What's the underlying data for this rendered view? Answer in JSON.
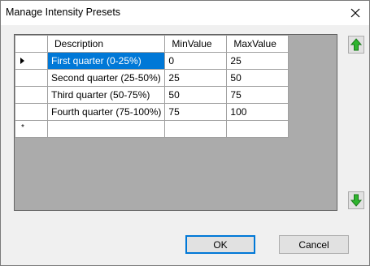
{
  "dialog": {
    "title": "Manage Intensity Presets"
  },
  "grid": {
    "columns": [
      "Description",
      "MinValue",
      "MaxValue"
    ],
    "rows": [
      {
        "description": "First quarter (0-25%)",
        "min": "0",
        "max": "25"
      },
      {
        "description": "Second quarter (25-50%)",
        "min": "25",
        "max": "50"
      },
      {
        "description": "Third quarter (50-75%)",
        "min": "50",
        "max": "75"
      },
      {
        "description": "Fourth quarter (75-100%)",
        "min": "75",
        "max": "100"
      }
    ],
    "new_row_marker": "*",
    "selected_row": 0
  },
  "buttons": {
    "ok_label": "OK",
    "cancel_label": "Cancel"
  },
  "icons": {
    "close": "close-icon",
    "move_up": "green-up-arrow-icon",
    "move_down": "green-down-arrow-icon",
    "current_row": "row-pointer-icon"
  },
  "colors": {
    "selection": "#0078d7",
    "grid_background": "#ababab",
    "arrow_green": "#2db52d"
  }
}
